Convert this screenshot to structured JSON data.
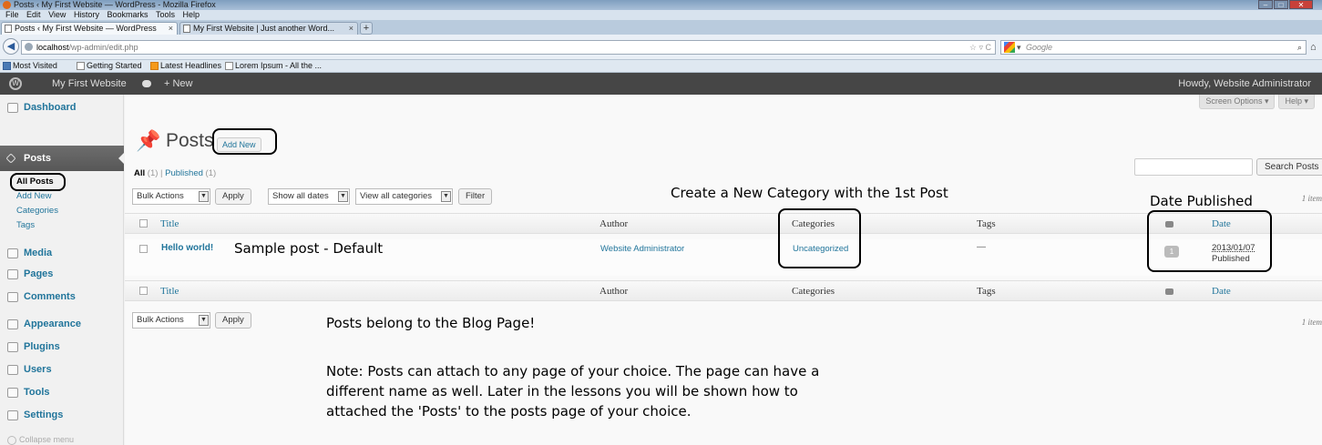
{
  "browser": {
    "window_title": "Posts ‹ My First Website — WordPress - Mozilla Firefox",
    "menu": [
      "File",
      "Edit",
      "View",
      "History",
      "Bookmarks",
      "Tools",
      "Help"
    ],
    "tabs": [
      {
        "label": "Posts ‹ My First Website — WordPress",
        "close": "×"
      },
      {
        "label": "My First Website | Just another Word...",
        "close": "×"
      }
    ],
    "new_tab": "+",
    "url_host": "localhost",
    "url_path": "/wp-admin/edit.php",
    "url_icons": "☆ ▿ C",
    "search_placeholder": "Google",
    "bookmarks": [
      "Most Visited",
      "Getting Started",
      "Latest Headlines",
      "Lorem Ipsum - All the ..."
    ],
    "window_controls": [
      "–",
      "□",
      "✕"
    ]
  },
  "adminbar": {
    "site_name": "My First Website",
    "new_label": "+ New",
    "howdy": "Howdy, Website Administrator"
  },
  "sidebar": {
    "items": [
      {
        "label": "Dashboard",
        "icon": "dashboard-icon"
      },
      {
        "label": "Posts",
        "icon": "pin-icon"
      },
      {
        "label": "Media",
        "icon": "media-icon"
      },
      {
        "label": "Pages",
        "icon": "pages-icon"
      },
      {
        "label": "Comments",
        "icon": "comments-icon"
      },
      {
        "label": "Appearance",
        "icon": "appearance-icon"
      },
      {
        "label": "Plugins",
        "icon": "plugin-icon"
      },
      {
        "label": "Users",
        "icon": "users-icon"
      },
      {
        "label": "Tools",
        "icon": "tools-icon"
      },
      {
        "label": "Settings",
        "icon": "settings-icon"
      }
    ],
    "posts_submenu": [
      "All Posts",
      "Add New",
      "Categories",
      "Tags"
    ],
    "collapse": "Collapse menu"
  },
  "main": {
    "screen_options": "Screen Options ▾",
    "help": "Help ▾",
    "title": "Posts",
    "add_new": "Add New",
    "filters": {
      "all": "All",
      "all_count": "(1)",
      "separator": "|",
      "published": "Published",
      "published_count": "(1)"
    },
    "search_button": "Search Posts",
    "bulk_actions": "Bulk Actions",
    "apply": "Apply",
    "all_dates": "Show all dates",
    "all_categories": "View all categories",
    "filter": "Filter",
    "items_count": "1 item",
    "columns": {
      "title": "Title",
      "author": "Author",
      "categories": "Categories",
      "tags": "Tags",
      "date": "Date"
    },
    "post": {
      "title": "Hello world!",
      "author": "Website Administrator",
      "category": "Uncategorized",
      "tags": "—",
      "comments": "1",
      "date": "2013/01/07",
      "status": "Published"
    }
  },
  "annotations": {
    "new_category": "Create a New Category with the 1st Post",
    "date_published": "Date Published",
    "sample_post": "Sample post - Default",
    "blog_page": "Posts belong to the Blog Page!",
    "note_lines": [
      "Note: Posts can attach to any page of your choice. The page can have a",
      "different name as well. Later in the lessons you will be shown how to",
      "attached the 'Posts' to the posts page of your choice."
    ]
  }
}
